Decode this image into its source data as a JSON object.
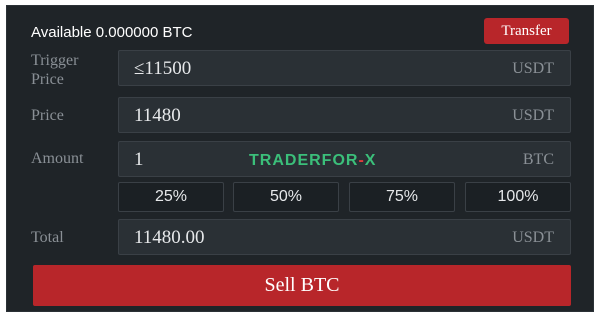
{
  "header": {
    "available_text": "Available 0.000000 BTC",
    "transfer_label": "Transfer"
  },
  "form": {
    "trigger_price": {
      "label": "Trigger Price",
      "value": "≤11500",
      "unit": "USDT"
    },
    "price": {
      "label": "Price",
      "value": "11480",
      "unit": "USDT"
    },
    "amount": {
      "label": "Amount",
      "value": "1",
      "unit": "BTC"
    },
    "total": {
      "label": "Total",
      "value": "11480.00",
      "unit": "USDT"
    }
  },
  "percent_buttons": [
    "25%",
    "50%",
    "75%",
    "100%"
  ],
  "watermark": {
    "part1": "TRADERFOR",
    "dash": "-",
    "part2": "X"
  },
  "sell_label": "Sell BTC",
  "colors": {
    "panel_bg": "#1f2428",
    "field_bg": "#2a3035",
    "accent_red": "#b8262a",
    "watermark_green": "#3bbf7a"
  }
}
